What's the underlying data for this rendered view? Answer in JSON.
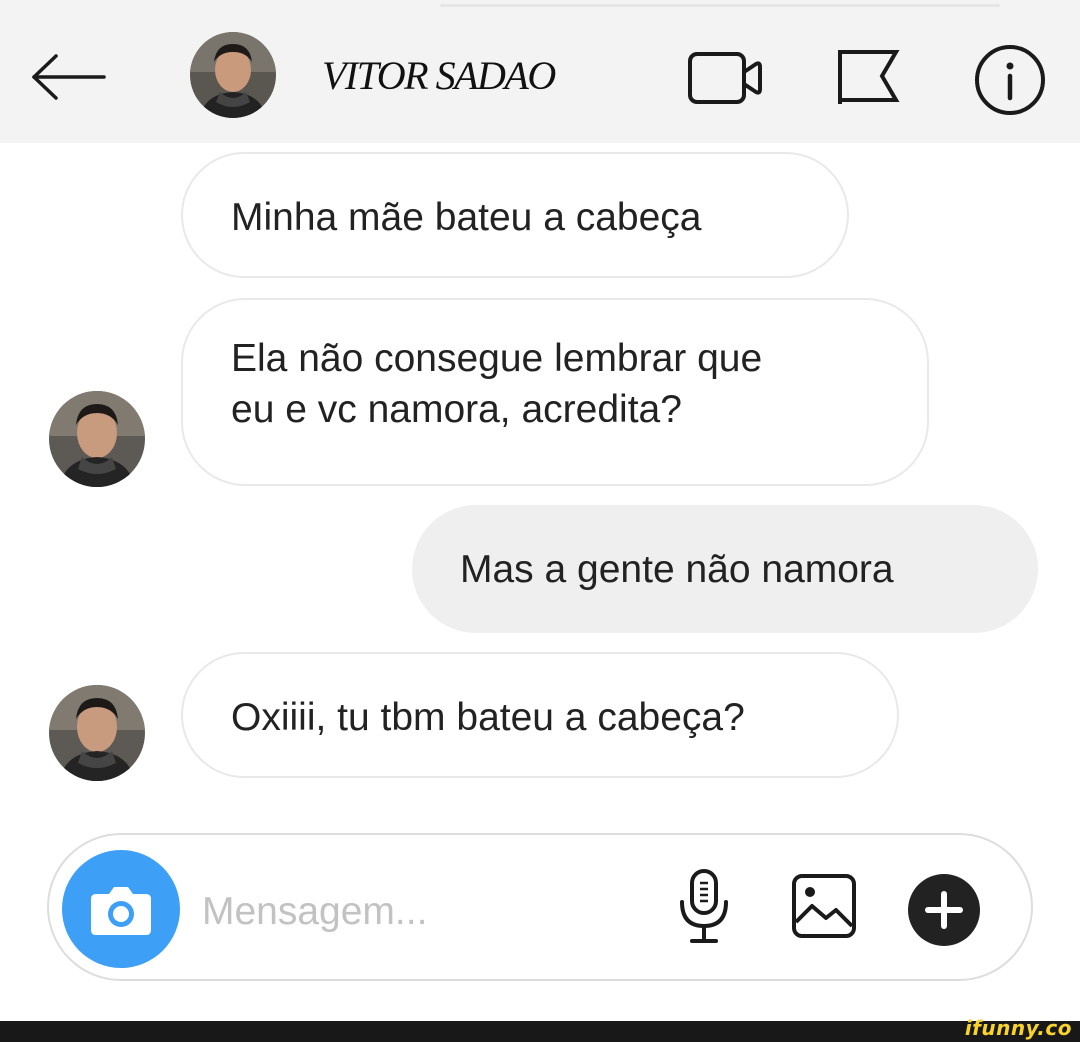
{
  "header": {
    "contact_name": "VITOR SADAO",
    "icons": {
      "back": "arrow-left-icon",
      "video": "video-camera-icon",
      "flag": "flag-icon",
      "info": "info-icon"
    },
    "background_color": "#f3f3f3"
  },
  "messages": [
    {
      "direction": "incoming",
      "text": "Minha mãe bateu a cabeça",
      "show_avatar": false
    },
    {
      "direction": "incoming",
      "lines": [
        "Ela não consegue lembrar que",
        "eu e vc namora, acredita?"
      ],
      "show_avatar": true
    },
    {
      "direction": "outgoing",
      "text": "Mas a gente não namora",
      "show_avatar": false
    },
    {
      "direction": "incoming",
      "text": "Oxiiii, tu tbm bateu a cabeça?",
      "show_avatar": true
    }
  ],
  "composer": {
    "value": "",
    "placeholder": "Mensagem...",
    "icons": {
      "camera": "camera-icon",
      "mic": "microphone-icon",
      "gallery": "image-gallery-icon",
      "plus": "plus-circle-icon"
    },
    "camera_color": "#3d9ff5"
  },
  "watermark": "ifunny.co",
  "colors": {
    "outgoing_bubble": "#efefef",
    "incoming_border": "#e9e9e9",
    "watermark_text": "#f7d32c",
    "watermark_bar": "#181818"
  }
}
